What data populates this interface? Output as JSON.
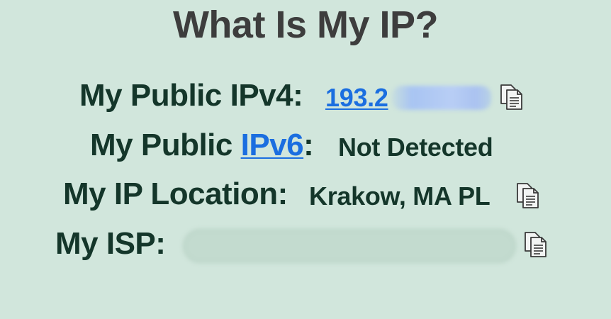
{
  "title": "What Is My IP?",
  "rows": {
    "ipv4": {
      "label": "My Public IPv4:",
      "value": "193.2"
    },
    "ipv6": {
      "label_prefix": "My Public ",
      "label_link": "IPv6",
      "label_suffix": ":",
      "value": "Not Detected"
    },
    "location": {
      "label": "My IP Location:",
      "value": "Krakow, MA PL"
    },
    "isp": {
      "label": "My ISP:"
    }
  },
  "icons": {
    "copy": "copy-document-icon"
  },
  "colors": {
    "background": "#d1e6dc",
    "title": "#3d3d3d",
    "text": "#14362a",
    "link": "#1b6ee0"
  }
}
